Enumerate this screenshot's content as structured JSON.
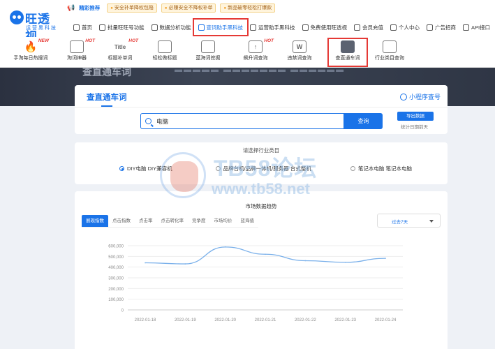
{
  "logo": {
    "name": "旺透视",
    "sub": "运营黑科技"
  },
  "notice": {
    "label": "精彩推荐",
    "chips": [
      "安全补单降权包赔",
      "必赚安全不降权补单",
      "新品破零轻松打爆款"
    ]
  },
  "mainnav": [
    {
      "label": "首页",
      "icon": "home-icon"
    },
    {
      "label": "批量旺旺号功能",
      "icon": "grid-icon"
    },
    {
      "label": "数据分析功能",
      "icon": "chart-icon"
    },
    {
      "label": "查词助手黑科技",
      "icon": "search-doc-icon"
    },
    {
      "label": "运营助手黑科技",
      "icon": "tools-icon"
    },
    {
      "label": "免费使用旺透视",
      "icon": "gift-icon"
    },
    {
      "label": "会员充值",
      "icon": "vip-icon"
    },
    {
      "label": "个人中心",
      "icon": "user-icon"
    },
    {
      "label": "广告招商",
      "icon": "ad-icon"
    },
    {
      "label": "API接口",
      "icon": "api-icon"
    }
  ],
  "tools": [
    {
      "label": "手淘每日热搜词",
      "badge": "NEW",
      "glyph": "🔥"
    },
    {
      "label": "淘词神器",
      "badge": "HOT",
      "glyph": ""
    },
    {
      "label": "标题补单词",
      "badge": "HOT",
      "glyph": "Title"
    },
    {
      "label": "轻松做标题",
      "badge": "",
      "glyph": ""
    },
    {
      "label": "蓝海词挖掘",
      "badge": "",
      "glyph": ""
    },
    {
      "label": "飙升词查询",
      "badge": "HOT",
      "glyph": "↑"
    },
    {
      "label": "违禁词查询",
      "badge": "",
      "glyph": "W"
    },
    {
      "label": "查直通车词",
      "badge": "",
      "glyph": ""
    },
    {
      "label": "行业类目查询",
      "badge": "",
      "glyph": ""
    }
  ],
  "banner": {
    "text": "查直通车词"
  },
  "search": {
    "title": "查直通车词",
    "mini_program": "小程序查号",
    "value": "电脑",
    "button": "查询",
    "export": "导出数据",
    "note": "统计日期前天"
  },
  "industry": {
    "title": "请选择行业类目",
    "options": [
      {
        "label": "DIY电脑 DIY兼容机",
        "checked": true
      },
      {
        "label": "品牌台机/品牌一体机/服务器 台式整机",
        "checked": false
      },
      {
        "label": "笔记本电脑 笔记本电脑",
        "checked": false
      }
    ]
  },
  "market": {
    "title": "市场数据趋势",
    "tabs": [
      "展现指数",
      "点击指数",
      "点击率",
      "点击转化率",
      "竞争度",
      "市场均价",
      "蓝海值"
    ],
    "range": "过去7天"
  },
  "chart_data": {
    "type": "line",
    "title": "市场数据趋势",
    "x": [
      "2022-01-18",
      "2022-01-19",
      "2022-01-20",
      "2022-01-21",
      "2022-01-22",
      "2022-01-23",
      "2022-01-24"
    ],
    "series": [
      {
        "name": "展现指数",
        "values": [
          440000,
          430000,
          588000,
          520000,
          460000,
          445000,
          482000
        ]
      }
    ],
    "y_ticks": [
      "600,000",
      "500,000",
      "400,000",
      "300,000",
      "200,000",
      "100,000",
      "0"
    ],
    "ylim": [
      0,
      600000
    ],
    "grid": true,
    "colors": {
      "line": "#7ab0ea"
    }
  },
  "watermark": {
    "line1": "TB58论坛",
    "line2": "www.tb58.net"
  }
}
